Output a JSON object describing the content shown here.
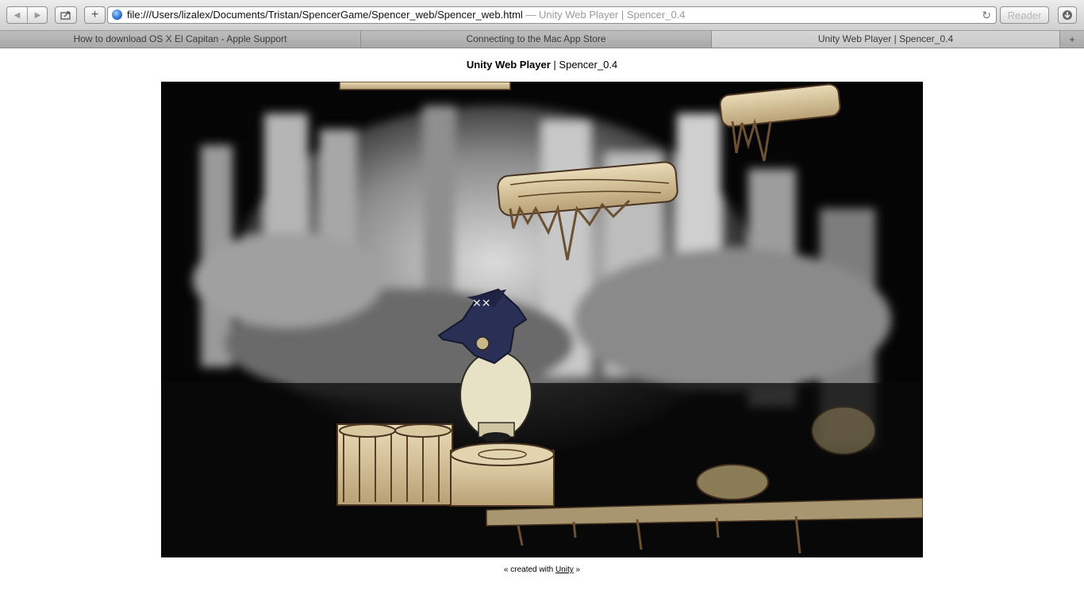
{
  "browser": {
    "address": {
      "url": "file:///Users/lizalex/Documents/Tristan/SpencerGame/Spencer_web/Spencer_web.html",
      "title_suffix": "— Unity Web Player | Spencer_0.4"
    },
    "reader_label": "Reader",
    "new_tab_symbol": "+",
    "tabs": [
      {
        "label": "How to download OS X El Capitan - Apple Support"
      },
      {
        "label": "Connecting to the Mac App Store"
      },
      {
        "label": "Unity Web Player | Spencer_0.4"
      }
    ]
  },
  "page": {
    "heading_bold": "Unity Web Player",
    "heading_sep": " | ",
    "heading_rest": "Spencer_0.4",
    "footer_prefix": "« created with ",
    "footer_link": "Unity",
    "footer_suffix": " »"
  }
}
